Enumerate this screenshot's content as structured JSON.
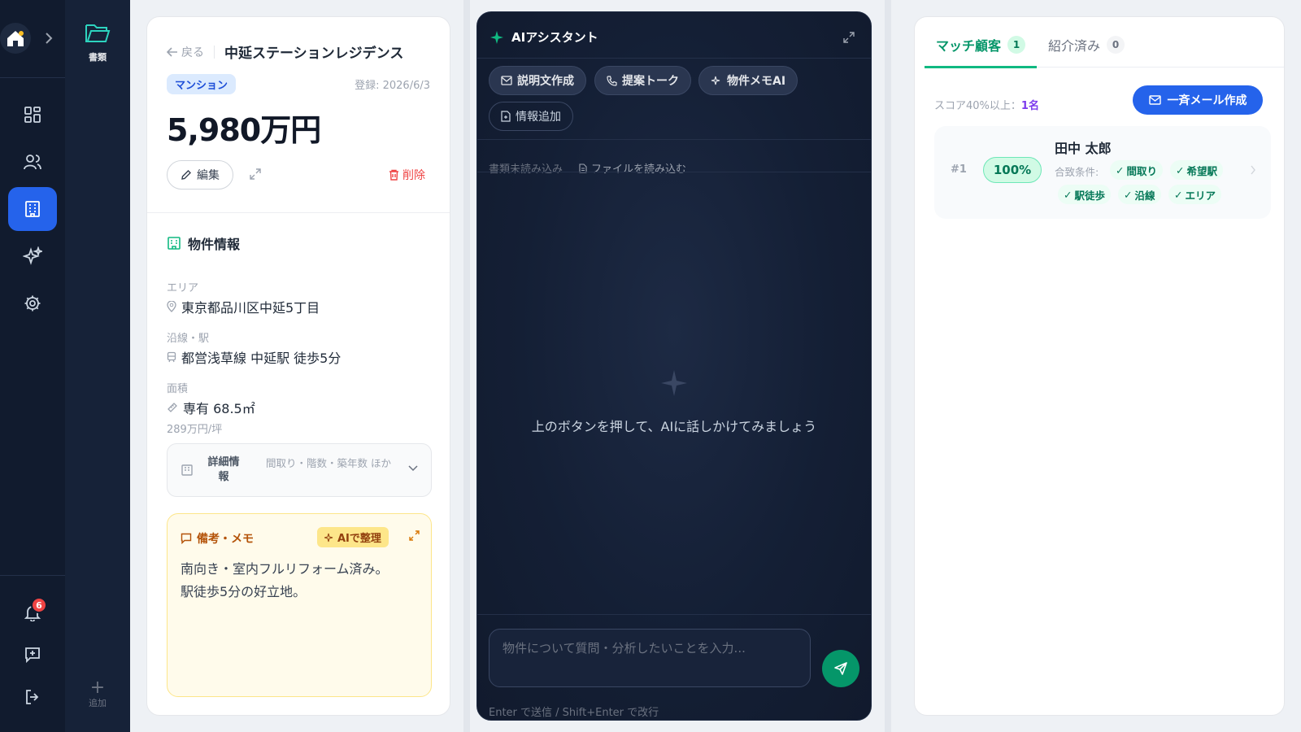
{
  "nav2": {
    "folder_label": "書類",
    "add_label": "追加",
    "add_glyph": "+"
  },
  "nav": {
    "notification_count": "6"
  },
  "property": {
    "back_label": "戻る",
    "title": "中延ステーションレジデンス",
    "type": "マンション",
    "registered": "登録: 2026/6/3",
    "price": "5,980万円",
    "edit_label": "編集",
    "delete_label": "削除",
    "section_title": "物件情報",
    "area_label": "エリア",
    "area_value": "東京都品川区中延5丁目",
    "line_label": "沿線・駅",
    "line_value": "都営浅草線 中延駅 徒歩5分",
    "size_label": "面積",
    "size_value": "専有 68.5㎡",
    "unit_price": "289万円/坪",
    "details_label": "詳細情報",
    "details_sub": "間取り・階数・築年数 ほか",
    "memo_title": "備考・メモ",
    "memo_ai_label": "AIで整理",
    "memo_line1": "南向き・室内フルリフォーム済み。",
    "memo_line2": "駅徒歩5分の好立地。"
  },
  "ai": {
    "title": "AIアシスタント",
    "chips": [
      "説明文作成",
      "提案トーク",
      "物件メモAI",
      "情報追加"
    ],
    "doc_status": "書類未読み込み",
    "file_label": "ファイルを読み込む",
    "empty_message": "上のボタンを押して、AIに話しかけてみましょう",
    "input_placeholder": "物件について質問・分析したいことを入力...",
    "hint": "Enter で送信 / Shift+Enter で改行"
  },
  "match": {
    "tab_active": "マッチ顧客",
    "tab_active_count": "1",
    "tab_inactive": "紹介済み",
    "tab_inactive_count": "0",
    "score_label": "スコア40%以上：",
    "score_value": "1名",
    "mail_button": "一斉メール作成",
    "customer": {
      "rank": "#1",
      "percent": "100%",
      "name": "田中 太郎",
      "cond_label": "合致条件:",
      "tags": [
        "間取り",
        "希望駅",
        "駅徒歩",
        "沿線",
        "エリア"
      ]
    }
  },
  "colors": {
    "accent_blue": "#2563eb",
    "accent_green": "#059669",
    "nav_bg": "#111b2e"
  }
}
